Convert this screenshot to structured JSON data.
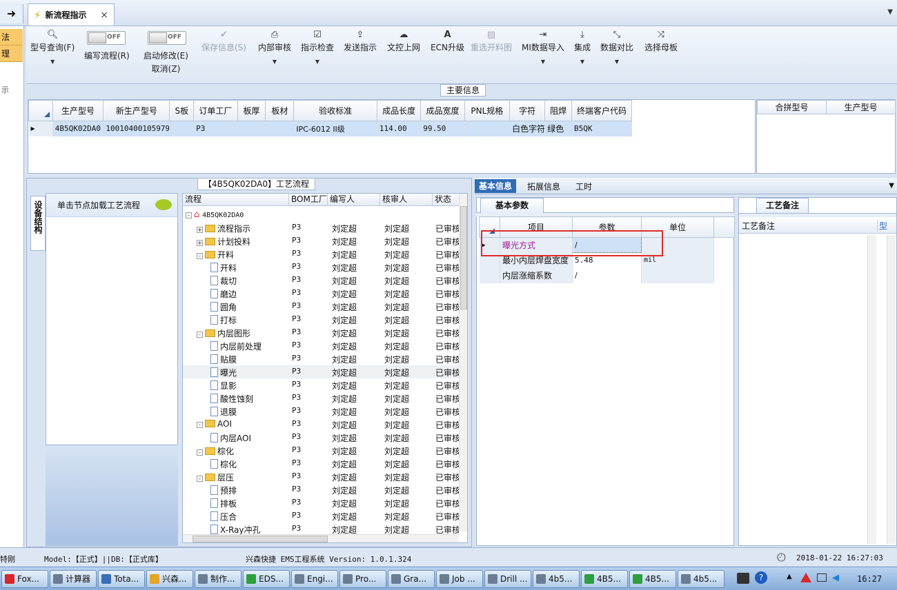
{
  "window_tab": {
    "title": "新流程指示",
    "close": "×"
  },
  "left_strip": {
    "items": [
      "法",
      "理"
    ],
    "frag": "示"
  },
  "toolbar": {
    "buttons": [
      {
        "label": "型号查询(F)",
        "icon": "search-icon",
        "enabled": true
      },
      {
        "label": "编写流程(R)",
        "toggle": "OFF",
        "enabled": true
      },
      {
        "label": "启动修改(E)",
        "sub": "取消(Z)",
        "toggle": "OFF",
        "enabled": true
      },
      {
        "label": "保存信息(S)",
        "icon": "check-icon",
        "enabled": false
      },
      {
        "label": "内部审核",
        "icon": "print-icon",
        "enabled": true
      },
      {
        "label": "指示检查",
        "icon": "checkbox-icon",
        "enabled": true
      },
      {
        "label": "发送指示",
        "icon": "upload-icon",
        "enabled": true
      },
      {
        "label": "文控上网",
        "icon": "cloud-upload-icon",
        "enabled": true
      },
      {
        "label": "ECN升级",
        "icon": "font-icon",
        "enabled": true
      },
      {
        "label": "重选开料图",
        "icon": "image-icon",
        "enabled": false
      },
      {
        "label": "MI数据导入",
        "icon": "sign-in-icon",
        "enabled": true
      },
      {
        "label": "集成",
        "icon": "download-icon",
        "enabled": true
      },
      {
        "label": "数据对比",
        "icon": "compress-icon",
        "enabled": true
      },
      {
        "label": "选择母板",
        "icon": "shuffle-icon",
        "enabled": true
      }
    ]
  },
  "main_info": {
    "title": "主要信息",
    "columns": [
      "生产型号",
      "新生产型号",
      "S板",
      "订单工厂",
      "板厚",
      "板材",
      "验收标准",
      "成品长度",
      "成品宽度",
      "PNL规格",
      "字符",
      "阻焊",
      "终端客户代码"
    ],
    "rows": [
      [
        "4B5QK02DA0",
        "10010400105979",
        "",
        "P3",
        "",
        "",
        "IPC-6012 II级",
        "114.00",
        "99.50",
        "",
        "白色字符",
        "绿色",
        "B5QK"
      ]
    ],
    "merge_columns": [
      "合拼型号",
      "生产型号"
    ]
  },
  "process": {
    "title": "【4B5QK02DA0】工艺流程",
    "side_tab": "设备结构",
    "load_hint": "单击节点加载工艺流程",
    "columns": [
      "流程",
      "BOM工厂",
      "编写人",
      "核审人",
      "状态"
    ],
    "root": "4B5QK02DA0",
    "rows": [
      {
        "name": "流程指示",
        "level": 1,
        "type": "folder",
        "exp": "+",
        "bom": "P3",
        "writer": "刘定超",
        "reviewer": "刘定超",
        "status": "已审核"
      },
      {
        "name": "计划投料",
        "level": 1,
        "type": "folder",
        "exp": "+",
        "bom": "P3",
        "writer": "刘定超",
        "reviewer": "刘定超",
        "status": "已审核"
      },
      {
        "name": "开料",
        "level": 1,
        "type": "folder",
        "exp": "-",
        "bom": "P3",
        "writer": "刘定超",
        "reviewer": "刘定超",
        "status": "已审核"
      },
      {
        "name": "开料",
        "level": 2,
        "type": "doc",
        "bom": "P3",
        "writer": "刘定超",
        "reviewer": "刘定超",
        "status": "已审核"
      },
      {
        "name": "裁切",
        "level": 2,
        "type": "doc",
        "bom": "P3",
        "writer": "刘定超",
        "reviewer": "刘定超",
        "status": "已审核"
      },
      {
        "name": "磨边",
        "level": 2,
        "type": "doc",
        "bom": "P3",
        "writer": "刘定超",
        "reviewer": "刘定超",
        "status": "已审核"
      },
      {
        "name": "圆角",
        "level": 2,
        "type": "doc",
        "bom": "P3",
        "writer": "刘定超",
        "reviewer": "刘定超",
        "status": "已审核"
      },
      {
        "name": "打标",
        "level": 2,
        "type": "doc",
        "bom": "P3",
        "writer": "刘定超",
        "reviewer": "刘定超",
        "status": "已审核"
      },
      {
        "name": "内层图形",
        "level": 1,
        "type": "folder",
        "exp": "-",
        "bom": "P3",
        "writer": "刘定超",
        "reviewer": "刘定超",
        "status": "已审核"
      },
      {
        "name": "内层前处理",
        "level": 2,
        "type": "doc",
        "bom": "P3",
        "writer": "刘定超",
        "reviewer": "刘定超",
        "status": "已审核"
      },
      {
        "name": "贴膜",
        "level": 2,
        "type": "doc",
        "bom": "P3",
        "writer": "刘定超",
        "reviewer": "刘定超",
        "status": "已审核"
      },
      {
        "name": "曝光",
        "level": 2,
        "type": "doc",
        "bom": "P3",
        "writer": "刘定超",
        "reviewer": "刘定超",
        "status": "已审核",
        "selected": true
      },
      {
        "name": "显影",
        "level": 2,
        "type": "doc",
        "bom": "P3",
        "writer": "刘定超",
        "reviewer": "刘定超",
        "status": "已审核"
      },
      {
        "name": "酸性蚀刻",
        "level": 2,
        "type": "doc",
        "bom": "P3",
        "writer": "刘定超",
        "reviewer": "刘定超",
        "status": "已审核"
      },
      {
        "name": "退膜",
        "level": 2,
        "type": "doc",
        "bom": "P3",
        "writer": "刘定超",
        "reviewer": "刘定超",
        "status": "已审核"
      },
      {
        "name": "AOI",
        "level": 1,
        "type": "folder",
        "exp": "-",
        "bom": "P3",
        "writer": "刘定超",
        "reviewer": "刘定超",
        "status": "已审核"
      },
      {
        "name": "内层AOI",
        "level": 2,
        "type": "doc",
        "bom": "P3",
        "writer": "刘定超",
        "reviewer": "刘定超",
        "status": "已审核"
      },
      {
        "name": "棕化",
        "level": 1,
        "type": "folder",
        "exp": "-",
        "bom": "P3",
        "writer": "刘定超",
        "reviewer": "刘定超",
        "status": "已审核"
      },
      {
        "name": "棕化",
        "level": 2,
        "type": "doc",
        "bom": "P3",
        "writer": "刘定超",
        "reviewer": "刘定超",
        "status": "已审核"
      },
      {
        "name": "层压",
        "level": 1,
        "type": "folder",
        "exp": "-",
        "bom": "P3",
        "writer": "刘定超",
        "reviewer": "刘定超",
        "status": "已审核"
      },
      {
        "name": "预排",
        "level": 2,
        "type": "doc",
        "bom": "P3",
        "writer": "刘定超",
        "reviewer": "刘定超",
        "status": "已审核"
      },
      {
        "name": "排板",
        "level": 2,
        "type": "doc",
        "bom": "P3",
        "writer": "刘定超",
        "reviewer": "刘定超",
        "status": "已审核"
      },
      {
        "name": "压合",
        "level": 2,
        "type": "doc",
        "bom": "P3",
        "writer": "刘定超",
        "reviewer": "刘定超",
        "status": "已审核"
      },
      {
        "name": "X-Ray冲孔",
        "level": 2,
        "type": "doc",
        "bom": "P3",
        "writer": "刘定超",
        "reviewer": "刘定超",
        "status": "已审核"
      }
    ]
  },
  "detail": {
    "tabs": [
      "基本信息",
      "拓展信息",
      "工时"
    ],
    "basic_tab": "基本参数",
    "param_columns": [
      "项目",
      "参数",
      "单位"
    ],
    "params": [
      {
        "item": "曝光方式",
        "value": "/",
        "unit": "",
        "selected": true
      },
      {
        "item": "最小内层焊盘宽度",
        "value": "5.48",
        "unit": "mil"
      },
      {
        "item": "内层涨缩系数",
        "value": "/",
        "unit": ""
      }
    ],
    "remark_tab": "工艺备注",
    "remark_columns": [
      "工艺备注",
      "型"
    ]
  },
  "status_bar": {
    "user_frag": "特刚",
    "model_info": "Model:【正式】||DB:【正式库】",
    "system": "兴森快捷 EMS工程系统 Version: 1.0.1.324",
    "datetime": "2018-01-22 16:27:03"
  },
  "taskbar": {
    "items": [
      "Fox...",
      "计算器",
      "Tota...",
      "兴森...",
      "制作...",
      "EDS...",
      "Engi...",
      "Pro...",
      "Gra...",
      "Job ...",
      "Drill ...",
      "4b5...",
      "4B5...",
      "4B5...",
      "4b5..."
    ],
    "clock": "16:27"
  },
  "colors": {
    "accent": "#2f6cb6",
    "highlight_text": "#a0179a",
    "red_box": "#e02a2a",
    "selected_row": "#cfe1f6"
  }
}
